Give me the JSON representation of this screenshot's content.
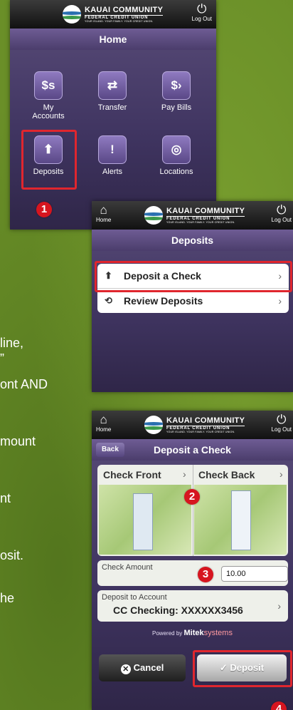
{
  "brand": {
    "name": "KAUAI COMMUNITY",
    "sub": "FEDERAL CREDIT UNION",
    "tagline": "YOUR ISLAND. YOUR FAMILY. YOUR CREDIT UNION."
  },
  "common": {
    "logout_label": "Log Out",
    "home_label": "Home",
    "power_glyph": "⏻",
    "home_glyph": "⌂"
  },
  "side_text": [
    "line,",
    "”",
    "ont AND",
    "mount",
    "nt",
    "osit.",
    "he"
  ],
  "screen1": {
    "title": "Home",
    "tiles": [
      {
        "label": "My Accounts",
        "icon": "$s",
        "icon_name": "accounts-icon"
      },
      {
        "label": "Transfer",
        "icon": "⇄",
        "icon_name": "transfer-icon"
      },
      {
        "label": "Pay Bills",
        "icon": "$›",
        "icon_name": "pay-bills-icon"
      },
      {
        "label": "Deposits",
        "icon": "⬆",
        "icon_name": "deposit-icon"
      },
      {
        "label": "Alerts",
        "icon": "!",
        "icon_name": "alert-icon"
      },
      {
        "label": "Locations",
        "icon": "◎",
        "icon_name": "locations-icon"
      }
    ],
    "step": "1"
  },
  "screen2": {
    "title": "Deposits",
    "items": [
      {
        "label": "Deposit a Check",
        "icon": "⬆",
        "chevron": "›"
      },
      {
        "label": "Review Deposits",
        "icon": "⟲",
        "chevron": "›"
      }
    ]
  },
  "screen3": {
    "back_label": "Back",
    "title": "Deposit a Check",
    "check_front": "Check Front",
    "check_back": "Check Back",
    "chevron": "›",
    "step2": "2",
    "amount_label": "Check Amount",
    "step3": "3",
    "amount_value": "10.00",
    "deposit_to_label": "Deposit to Account",
    "account_value": "CC Checking: XXXXXX3456",
    "powered_by": "Powered by",
    "powered_brand": "Mitek",
    "powered_brand2": "systems",
    "cancel_label": "Cancel",
    "deposit_label": "✓ Deposit",
    "step4": "4"
  },
  "colors": {
    "highlight": "#e0262e",
    "badge": "#d6151f",
    "purple": "#4b3d6c"
  }
}
